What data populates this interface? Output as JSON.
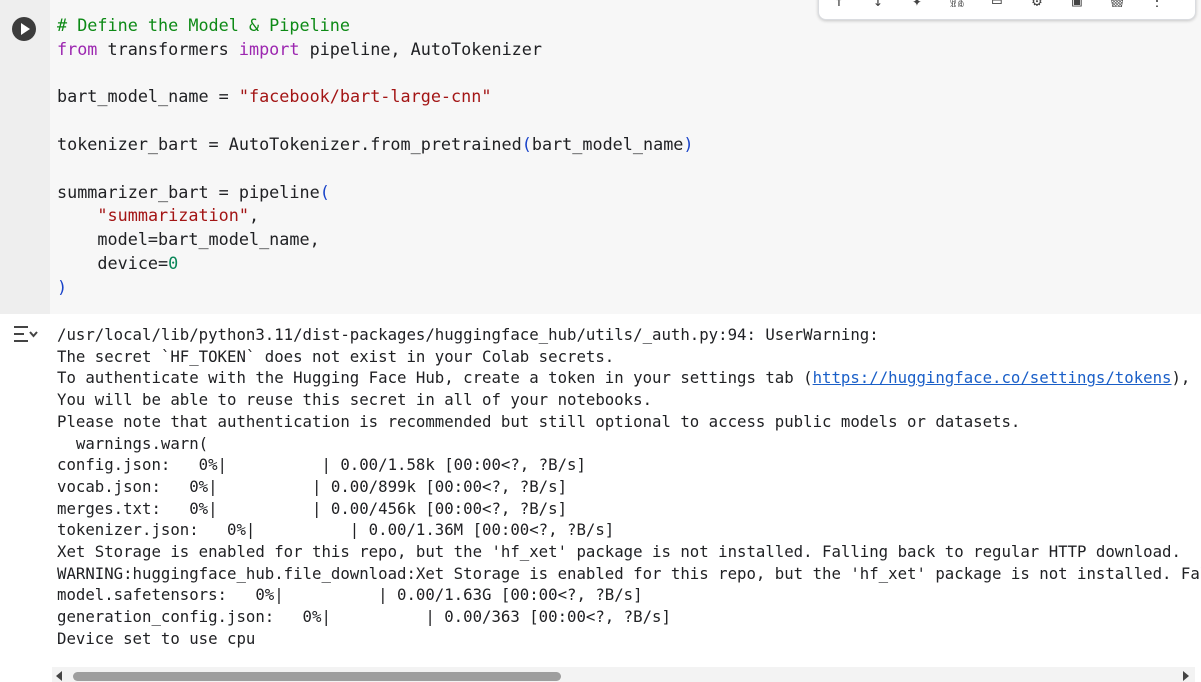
{
  "toolbar": {
    "icons": [
      "arrow-up-icon",
      "arrow-down-icon",
      "sparkle-icon",
      "link-icon",
      "comment-icon",
      "gear-icon",
      "mirror-cell-icon",
      "delete-icon",
      "more-vert-icon"
    ]
  },
  "code": {
    "line1_comment": "# Define the Model & Pipeline",
    "line2_from": "from",
    "line2_module": " transformers ",
    "line2_import": "import",
    "line2_names": " pipeline, AutoTokenizer",
    "line4_name": "bart_model_name = ",
    "line4_string": "\"facebook/bart-large-cnn\"",
    "line6_a": "tokenizer_bart = AutoTokenizer.from_pretrained",
    "line6_open": "(",
    "line6_arg": "bart_model_name",
    "line6_close": ")",
    "line8_a": "summarizer_bart = pipeline",
    "line8_open": "(",
    "line9_indent": "    ",
    "line9_string": "\"summarization\"",
    "line9_comma": ",",
    "line10": "    model=bart_model_name,",
    "line11_a": "    device=",
    "line11_num": "0",
    "line12_close": ")"
  },
  "output": {
    "l1": "/usr/local/lib/python3.11/dist-packages/huggingface_hub/utils/_auth.py:94: UserWarning:",
    "l2": "The secret `HF_TOKEN` does not exist in your Colab secrets.",
    "l3_a": "To authenticate with the Hugging Face Hub, create a token in your settings tab (",
    "l3_link": "https://huggingface.co/settings/tokens",
    "l3_b": "), set it as secret in your Google Colab and restart your session.",
    "l4": "You will be able to reuse this secret in all of your notebooks.",
    "l5": "Please note that authentication is recommended but still optional to access public models or datasets.",
    "l6": "  warnings.warn(",
    "l7": "config.json:   0%|          | 0.00/1.58k [00:00<?, ?B/s]",
    "l8": "vocab.json:   0%|          | 0.00/899k [00:00<?, ?B/s]",
    "l9": "merges.txt:   0%|          | 0.00/456k [00:00<?, ?B/s]",
    "l10": "tokenizer.json:   0%|          | 0.00/1.36M [00:00<?, ?B/s]",
    "l11": "Xet Storage is enabled for this repo, but the 'hf_xet' package is not installed. Falling back to regular HTTP download.",
    "l12": "WARNING:huggingface_hub.file_download:Xet Storage is enabled for this repo, but the 'hf_xet' package is not installed. Falling back to regular HTTP download.",
    "l13": "model.safetensors:   0%|          | 0.00/1.63G [00:00<?, ?B/s]",
    "l14": "generation_config.json:   0%|          | 0.00/363 [00:00<?, ?B/s]",
    "l15": "Device set to use cpu"
  }
}
